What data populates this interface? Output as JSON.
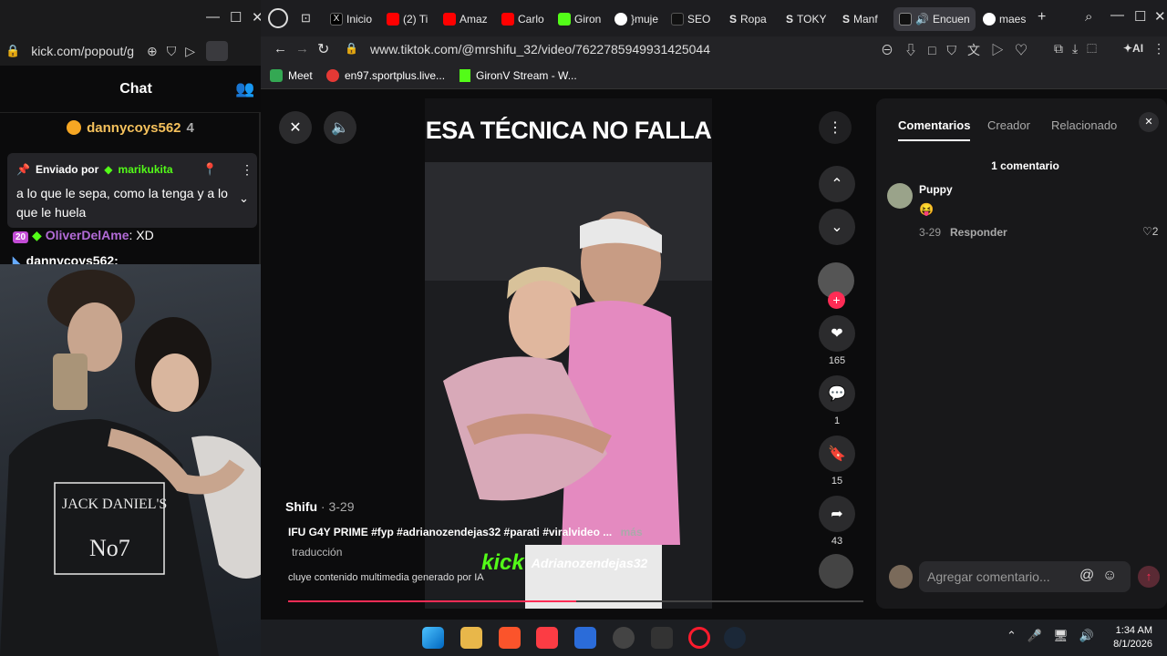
{
  "kick": {
    "url": "kick.com/popout/g",
    "header_title": "Chat",
    "top_user": "dannycoys562",
    "top_count": "4",
    "pinned": {
      "sent_by_label": "Enviado por",
      "sender": "marikukita",
      "message": "a lo que le sepa, como la tenga y a lo que le huela"
    },
    "chat_lines": [
      {
        "badge": "20",
        "user": "OliverDelAme",
        "text": "XD"
      },
      {
        "badge": "",
        "user": "dannycoys562",
        "text": ""
      }
    ]
  },
  "browser": {
    "tabs": [
      {
        "label": "Inicio",
        "color": "#000000"
      },
      {
        "label": "(2) Ti",
        "color": "#ff0000"
      },
      {
        "label": "Amaz",
        "color": "#ff0000"
      },
      {
        "label": "Carlo",
        "color": "#ff0000"
      },
      {
        "label": "Giron",
        "color": "#53fc18"
      },
      {
        "label": "}muje",
        "color": "#4285f4"
      },
      {
        "label": "SEO",
        "color": "#111111"
      },
      {
        "label": "Ropa",
        "color": "#444444"
      },
      {
        "label": "TOKY",
        "color": "#444444"
      },
      {
        "label": "Manf",
        "color": "#444444"
      },
      {
        "label": "Encuen",
        "color": "#111111"
      },
      {
        "label": "maes",
        "color": "#4285f4"
      }
    ],
    "url": "www.tiktok.com/@mrshifu_32/video/7622785949931425044",
    "bookmarks": [
      {
        "label": "Meet",
        "color": "#34a853"
      },
      {
        "label": "en97.sportplus.live...",
        "color": "#e53935"
      },
      {
        "label": "GironV Stream - W...",
        "color": "#53fc18"
      }
    ]
  },
  "video": {
    "title": "ESA TÉCNICA NO FALLA",
    "author": "Shifu",
    "date": "3-29",
    "caption": "IFU G4Y PRIME #fyp #adrianozendejas32 #parati #viralvideo ...",
    "more_label": "más",
    "translation": "traducción",
    "ai_notice": "cluye contenido multimedia generado por IA",
    "watermark": "Adrianozendejas32",
    "kick_logo": "kick",
    "progress": 0.5,
    "likes": "165",
    "comments": "1",
    "saves": "15",
    "shares": "43"
  },
  "comments_panel": {
    "tabs": [
      "Comentarios",
      "Creador",
      "Relacionado"
    ],
    "count_label": "1 comentario",
    "comment": {
      "user": "Puppy",
      "emoji": "😝",
      "date": "3-29",
      "reply_label": "Responder",
      "likes": "2"
    },
    "input_placeholder": "Agregar comentario..."
  },
  "taskbar": {
    "time": "1:34 AM",
    "date": "8/1/2026"
  }
}
